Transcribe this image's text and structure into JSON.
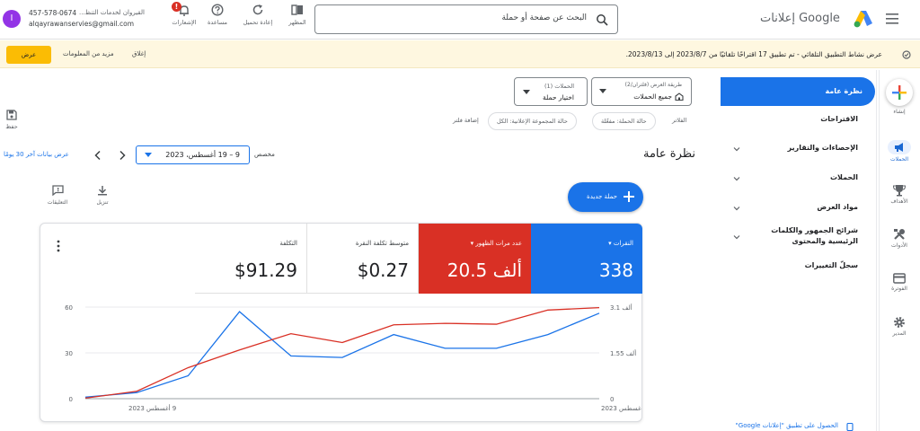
{
  "header": {
    "app_name": "إعلانات Google",
    "search_placeholder": "البحث عن صفحة أو حملة",
    "toolbar": {
      "appearance": "المظهر",
      "refresh": "إعادة تحميل",
      "help": "مساعدة",
      "notifications": "الإشعارات"
    },
    "account": {
      "phone": "457-578-0674",
      "name": "القيروان لخدمات التنظ...",
      "email": "alqayrawanservies@gmail.com",
      "avatar_letter": "I",
      "avatar_color": "#9334e6"
    }
  },
  "banner": {
    "message": "عرض نشاط التطبيق التلقائي - تم تطبيق 17 اقتراحًا تلقائيًا من 2023/8/7 إلى 2023/8/13.",
    "close": "إغلاق",
    "more_info": "مزيد من المعلومات",
    "view": "عرض"
  },
  "rail": {
    "create": "إنشاء",
    "campaigns": "الحملات",
    "goals": "الأهداف",
    "tools": "الأدوات",
    "billing": "الفوترة",
    "admin": "المدير"
  },
  "nav": {
    "items": [
      "نظرة عامة",
      "الاقتراحات",
      "الإحصاءات والتقارير",
      "الحملات",
      "مواد العرض",
      "شرائح الجمهور والكلمات الرئيسية والمحتوى",
      "سجلّ التغييرات"
    ],
    "footer_link": "الحصول على تطبيق \"إعلانات Google\""
  },
  "selectors": {
    "view_label": "طريقة العرض (فلتران/2)",
    "view_value": "جميع الحملات",
    "campaigns_label": "الحملات (1)",
    "campaigns_value": "اختيار حملة"
  },
  "filters": {
    "label": "الفلاتر",
    "chips": [
      "حالة الحملة: مفعّلة",
      "حالة المجموعة الإعلانية: الكل",
      "إضافة فلتر"
    ]
  },
  "page": {
    "title": "نظرة عامة",
    "date_mode": "مخصص",
    "date_range": "9 – 19 أغسطس، 2023",
    "last30": "عرض بيانات آخر 30 يومًا",
    "save": "حفظ",
    "new_campaign": "حملة جديدة",
    "download": "تنزيل",
    "comments": "التعليقات"
  },
  "metrics": [
    {
      "label": "النقرات",
      "value": "338",
      "color": "#1a73e8"
    },
    {
      "label": "عدد مرات الظهور",
      "value": "20.5 ألف",
      "color": "#d93025"
    },
    {
      "label": "متوسط تكلفة النقرة",
      "value": "$0.27",
      "color": "#ffffff"
    },
    {
      "label": "التكلفة",
      "value": "$91.29",
      "color": "#ffffff"
    }
  ],
  "chart_data": {
    "type": "line",
    "x": [
      "9 أغسطس 2023",
      "10",
      "11",
      "12",
      "13",
      "14",
      "15",
      "16",
      "17",
      "18",
      "19 أغسطس 2023"
    ],
    "x_tick_labels": [
      "9 أغسطس 2023",
      "19 أغسطس 2023"
    ],
    "series": [
      {
        "name": "النقرات",
        "color": "#1a73e8",
        "axis": "left",
        "values": [
          1,
          4,
          15,
          57,
          28,
          27,
          42,
          33,
          33,
          42,
          56
        ]
      },
      {
        "name": "عدد مرات الظهور",
        "color": "#d93025",
        "axis": "right",
        "values": [
          0.02,
          0.25,
          1.05,
          1.65,
          2.2,
          1.9,
          2.5,
          2.55,
          2.52,
          3.0,
          3.08
        ]
      }
    ],
    "left_axis": {
      "ticks": [
        "0",
        "30",
        "60"
      ],
      "ylim": [
        0,
        60
      ]
    },
    "right_axis": {
      "ticks": [
        "0",
        "1.55 ألف",
        "3.1 ألف"
      ],
      "ylim": [
        0,
        3.1
      ]
    },
    "grid": true
  }
}
